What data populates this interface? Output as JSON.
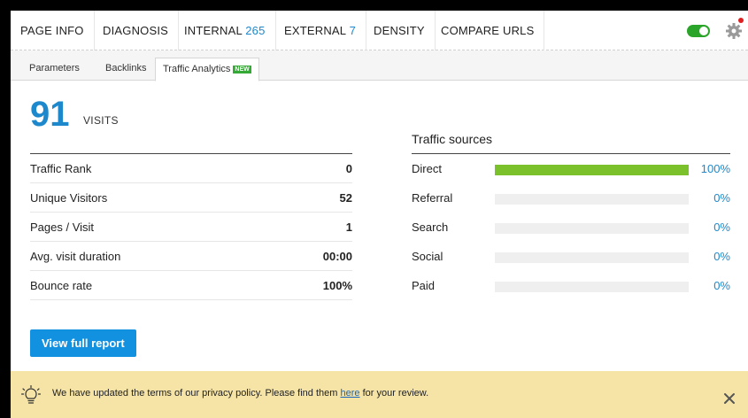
{
  "nav": {
    "tabs": [
      {
        "label": "PAGE INFO",
        "count": ""
      },
      {
        "label": "DIAGNOSIS",
        "count": ""
      },
      {
        "label": "INTERNAL",
        "count": "265"
      },
      {
        "label": "EXTERNAL",
        "count": "7"
      },
      {
        "label": "DENSITY",
        "count": ""
      },
      {
        "label": "COMPARE URLS",
        "count": ""
      }
    ],
    "toggle_on": true
  },
  "subtabs": {
    "parameters": "Parameters",
    "backlinks": "Backlinks",
    "traffic": "Traffic Analytics",
    "new_badge": "NEW"
  },
  "visits": {
    "value": "91",
    "label": "VISITS"
  },
  "stats": [
    {
      "label": "Traffic Rank",
      "value": "0"
    },
    {
      "label": "Unique Visitors",
      "value": "52"
    },
    {
      "label": "Pages / Visit",
      "value": "1"
    },
    {
      "label": "Avg. visit duration",
      "value": "00:00"
    },
    {
      "label": "Bounce rate",
      "value": "100%"
    }
  ],
  "traffic_sources": {
    "title": "Traffic sources",
    "items": [
      {
        "label": "Direct",
        "percent_text": "100%",
        "percent": 100
      },
      {
        "label": "Referral",
        "percent_text": "0%",
        "percent": 0
      },
      {
        "label": "Search",
        "percent_text": "0%",
        "percent": 0
      },
      {
        "label": "Social",
        "percent_text": "0%",
        "percent": 0
      },
      {
        "label": "Paid",
        "percent_text": "0%",
        "percent": 0
      }
    ]
  },
  "report_button": "View full report",
  "notice": {
    "before": "We have updated the terms of our privacy policy. Please find them ",
    "link": "here",
    "after": " for your review."
  },
  "colors": {
    "accent": "#1e88cc",
    "button": "#1391e1",
    "bar_fill": "#7ac12c",
    "notice_bg": "#f6e4a6",
    "toggle": "#2aa52a"
  }
}
